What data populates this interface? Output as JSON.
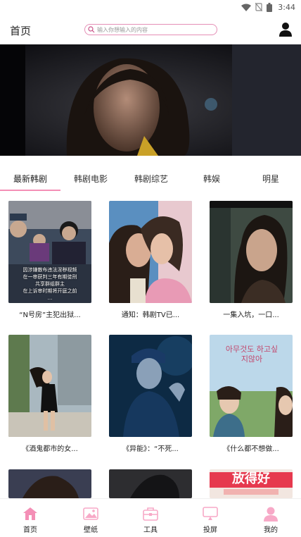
{
  "status_bar": {
    "time": "3:44"
  },
  "header": {
    "title": "首页",
    "search": {
      "placeholder": "输入你想输入的内容"
    }
  },
  "tabs": [
    {
      "label": "最新韩剧",
      "active": true
    },
    {
      "label": "韩剧电影"
    },
    {
      "label": "韩剧综艺"
    },
    {
      "label": "韩娱"
    },
    {
      "label": "明星"
    }
  ],
  "cards": [
    {
      "caption": "“N号房”主犯出狱...",
      "overlay": [
        "因涉嫌散布违法淫秽视频",
        "在一审获判三年有期徒刑",
        "共享群组群主",
        "在上诉审时期将开庭之前",
        "..."
      ]
    },
    {
      "caption": "通知：韩剧TV已..."
    },
    {
      "caption": "一集入坑，一口..."
    },
    {
      "caption": "《酒鬼都市的女..."
    },
    {
      "caption": "《异能》：“不死..."
    },
    {
      "caption": "《什么都不想做...",
      "overlay_title": "아무것도 하고싶지않아"
    },
    {
      "caption": ""
    },
    {
      "caption": ""
    },
    {
      "caption": "",
      "overlay_title": "放得好"
    }
  ],
  "bottom_nav": [
    {
      "label": "首页",
      "icon": "home-icon",
      "active": true
    },
    {
      "label": "壁纸",
      "icon": "image-icon"
    },
    {
      "label": "工具",
      "icon": "toolbox-icon"
    },
    {
      "label": "投屏",
      "icon": "cast-icon"
    },
    {
      "label": "我的",
      "icon": "person-icon"
    }
  ],
  "colors": {
    "accent": "#f48fb6",
    "search_border": "#e58fb6",
    "nav_icon": "#f7a9c7"
  }
}
